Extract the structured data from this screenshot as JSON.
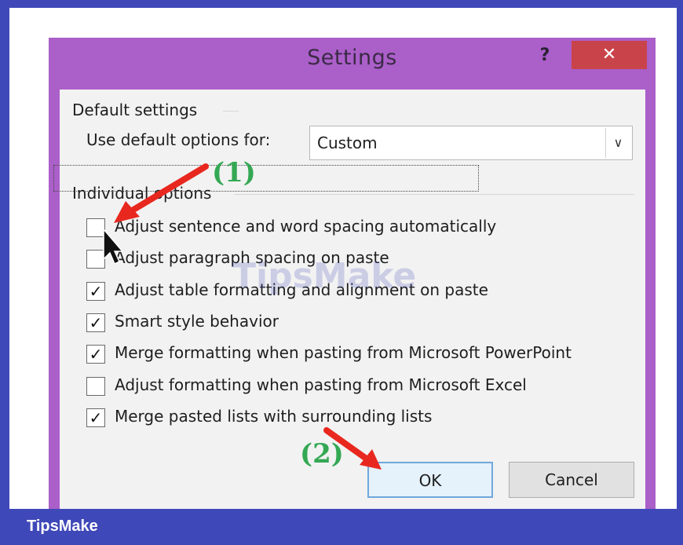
{
  "dialog": {
    "title": "Settings",
    "help_label": "?",
    "close_label": "✕",
    "default_settings_label": "Default settings",
    "use_default_label": "Use default options for:",
    "use_default_value": "Custom",
    "dropdown_arrow": "∨",
    "individual_options_label": "Individual options",
    "options": [
      {
        "label": "Adjust sentence and word spacing automatically",
        "checked": false
      },
      {
        "label": "Adjust paragraph spacing on paste",
        "checked": false
      },
      {
        "label": "Adjust table formatting and alignment on paste",
        "checked": true
      },
      {
        "label": "Smart style behavior",
        "checked": true
      },
      {
        "label": "Merge formatting when pasting from Microsoft PowerPoint",
        "checked": true
      },
      {
        "label": "Adjust formatting when pasting from Microsoft Excel",
        "checked": false
      },
      {
        "label": "Merge pasted lists with surrounding lists",
        "checked": true
      }
    ],
    "ok_label": "OK",
    "cancel_label": "Cancel"
  },
  "annotations": {
    "step1": "(1)",
    "step2": "(2)",
    "arrow_color": "#e8281f"
  },
  "watermark": "TipsMake",
  "footer": {
    "brand": "TipsMake"
  },
  "colors": {
    "frame": "#3f48b8",
    "dialog_border": "#ab5fc9",
    "close": "#c9434a"
  }
}
